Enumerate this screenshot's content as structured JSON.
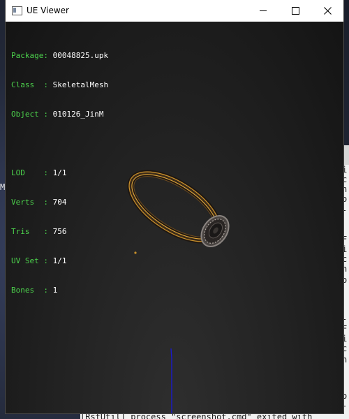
{
  "window": {
    "title": "UE Viewer",
    "minimize_label": "Minimize",
    "maximize_label": "Maximize",
    "close_label": "Close"
  },
  "mesh_info": [
    {
      "label": "Package",
      "sep": ": ",
      "value": "00048825.upk"
    },
    {
      "label": "Class  ",
      "sep": ": ",
      "value": "SkeletalMesh"
    },
    {
      "label": "Object ",
      "sep": ": ",
      "value": "010126_JinM"
    }
  ],
  "mesh_stats": [
    {
      "label": "LOD    ",
      "sep": ": ",
      "value": "1/1"
    },
    {
      "label": "Verts  ",
      "sep": ": ",
      "value": "704"
    },
    {
      "label": "Tris   ",
      "sep": ": ",
      "value": "756"
    },
    {
      "label": "UV Set ",
      "sep": ": ",
      "value": "1/1"
    },
    {
      "label": "Bones  ",
      "sep": ": ",
      "value": "1"
    }
  ],
  "background": {
    "left_edge_char": "M",
    "console_chars": [
      "i",
      "c",
      "h",
      "o",
      "-",
      "F",
      "i",
      "c",
      "h",
      "o",
      "-",
      "F",
      "i",
      "c",
      "h",
      "o",
      "-",
      "N",
      "i"
    ],
    "bottom_console_text": "[RstUtil] process \"screenshot.cmd\" exited with"
  },
  "colors": {
    "label_green": "#4cd14c",
    "value_white": "#ffffff",
    "viewport_bg": "#232323",
    "ring_gold": "#c8902c",
    "axis_blue": "#1a1acc"
  },
  "icons": [
    "app-window-icon",
    "minimize-icon",
    "maximize-icon",
    "close-icon"
  ]
}
